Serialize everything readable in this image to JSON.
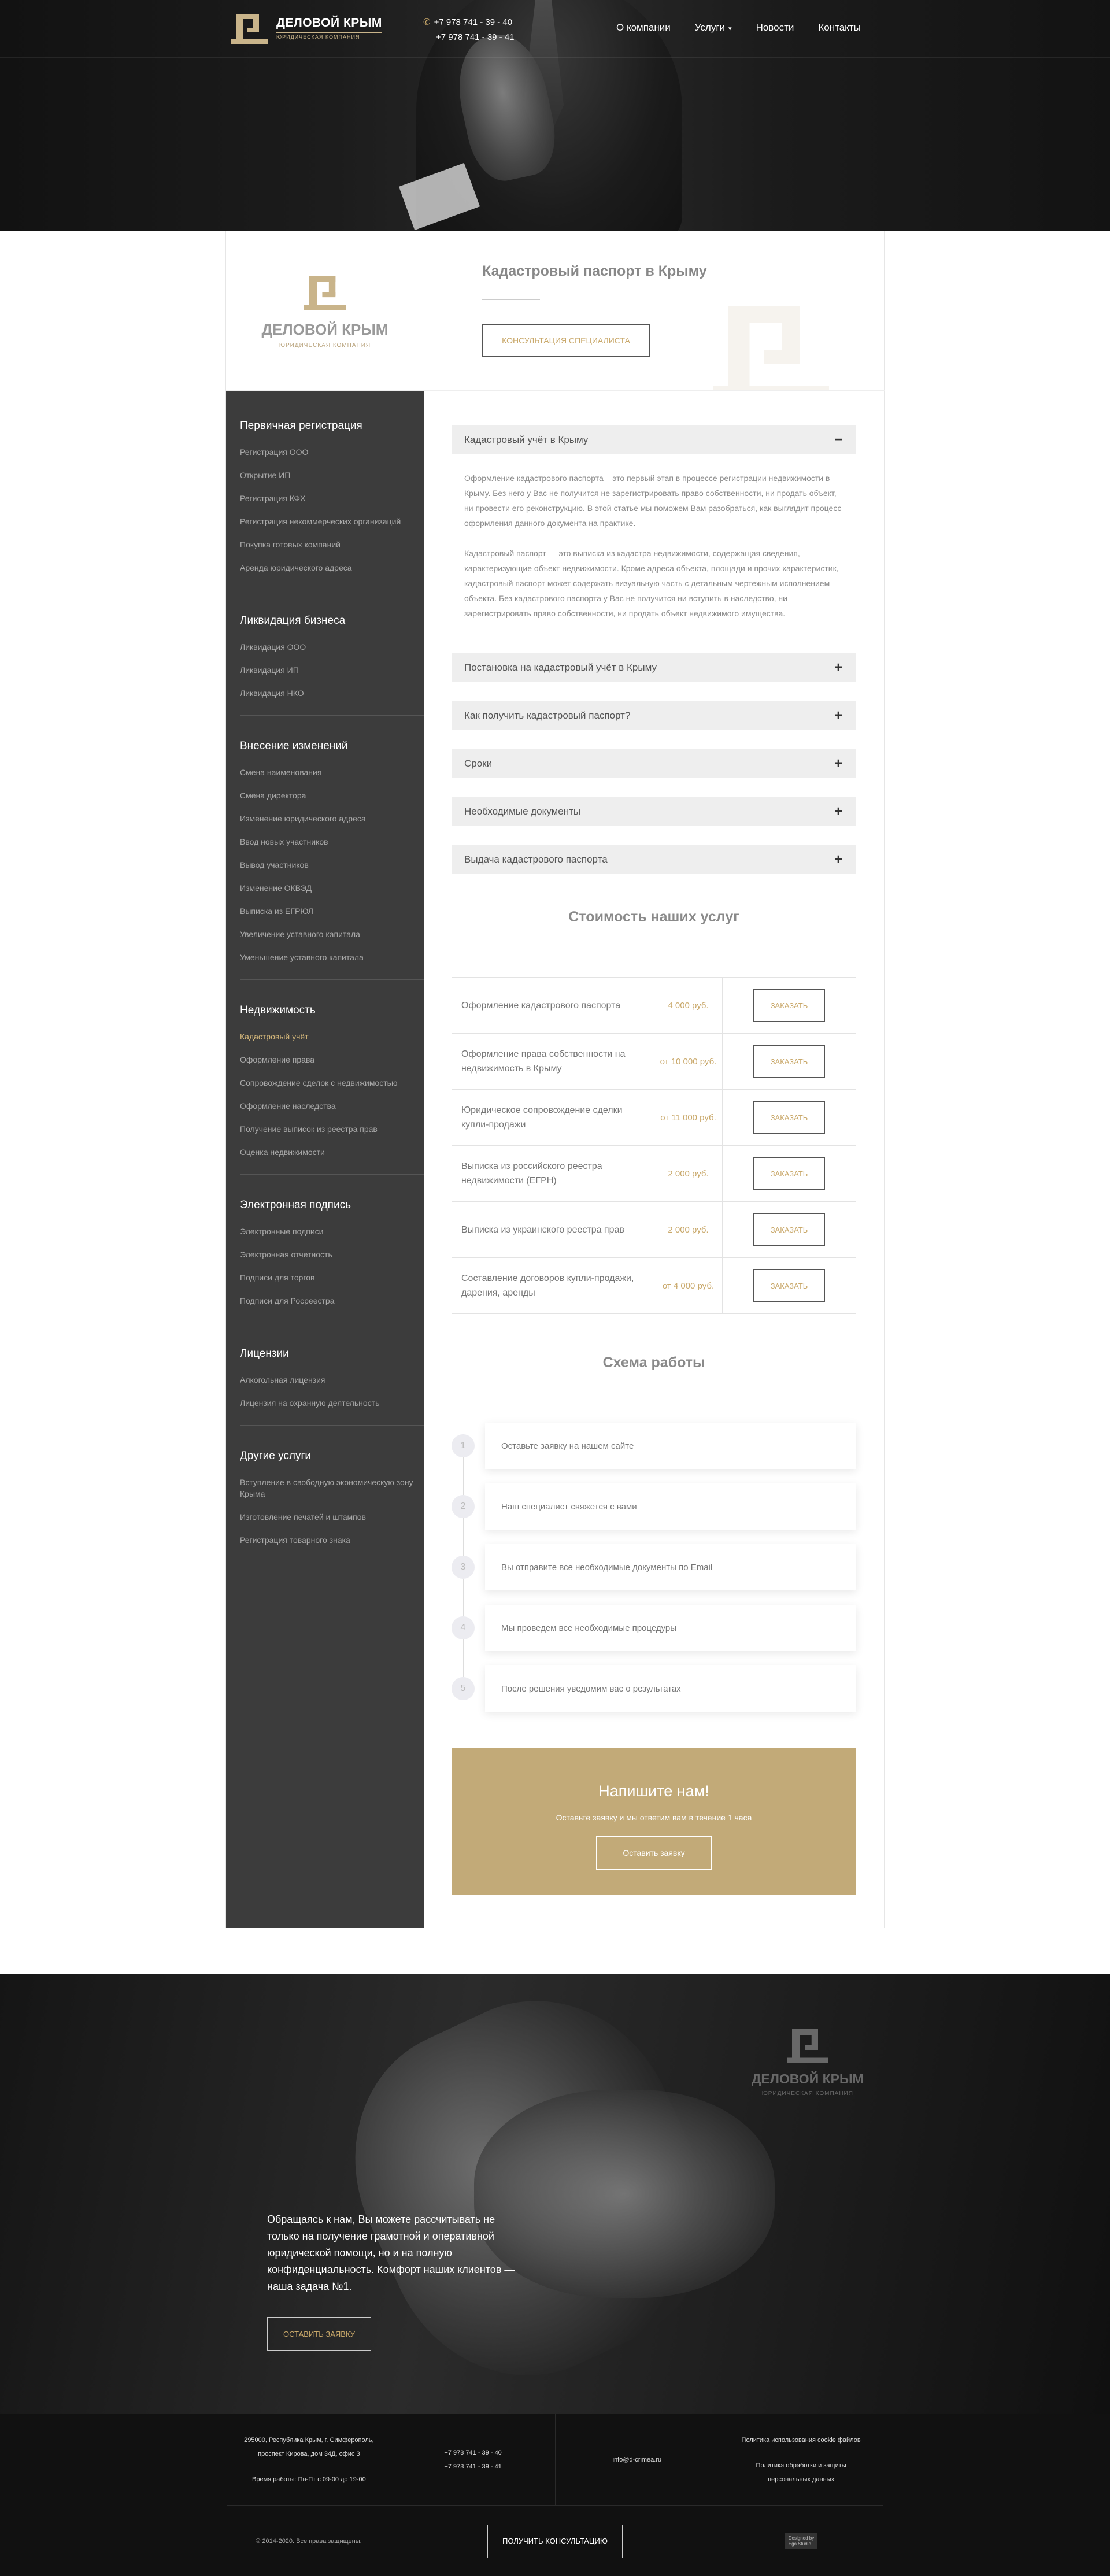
{
  "header": {
    "logo_name": "ДЕЛОВОЙ КРЫМ",
    "logo_sub": "ЮРИДИЧЕСКАЯ КОМПАНИЯ",
    "phone1": "+7 978 741 - 39 - 40",
    "phone2": "+7 978 741 - 39 - 41",
    "nav": [
      "О компании",
      "Услуги",
      "Новости",
      "Контакты"
    ]
  },
  "page": {
    "title": "Кадастровый паспорт в Крыму",
    "consult_button": "КОНСУЛЬТАЦИЯ СПЕЦИАЛИСТА"
  },
  "sidebar": {
    "logo_name": "ДЕЛОВОЙ КРЫМ",
    "logo_sub": "ЮРИДИЧЕСКАЯ КОМПАНИЯ",
    "groups": [
      {
        "title": "Первичная регистрация",
        "items": [
          "Регистрация ООО",
          "Открытие ИП",
          "Регистрация КФХ",
          "Регистрация некоммерческих организаций",
          "Покупка готовых компаний",
          "Аренда юридического адреса"
        ]
      },
      {
        "title": "Ликвидация бизнеса",
        "items": [
          "Ликвидация ООО",
          "Ликвидация ИП",
          "Ликвидация НКО"
        ]
      },
      {
        "title": "Внесение изменений",
        "items": [
          "Смена наименования",
          "Смена директора",
          "Изменение юридического адреса",
          "Ввод новых участников",
          "Вывод участников",
          "Изменение ОКВЭД",
          "Выписка из ЕГРЮЛ",
          "Увеличение уставного капитала",
          "Уменьшение уставного капитала"
        ]
      },
      {
        "title": "Недвижимость",
        "items": [
          "Кадастровый учёт",
          "Оформление права",
          "Сопровождение сделок с недвижимостью",
          "Оформление наследства",
          "Получение выписок из реестра прав",
          "Оценка недвижимости"
        ]
      },
      {
        "title": "Электронная подпись",
        "items": [
          "Электронные подписи",
          "Электронная отчетность",
          "Подписи для торгов",
          "Подписи для Росреестра"
        ]
      },
      {
        "title": "Лицензии",
        "items": [
          "Алкогольная лицензия",
          "Лицензия на охранную деятельность"
        ]
      },
      {
        "title": "Другие услуги",
        "items": [
          "Вступление в свободную экономическую зону Крыма",
          "Изготовление печатей и штампов",
          "Регистрация товарного знака"
        ]
      }
    ]
  },
  "accordion": {
    "open_title": "Кадастровый учёт в Крыму",
    "open_sign": "−",
    "paragraph1": "Оформление кадастрового паспорта – это первый этап в процессе регистрации недвижимости в Крыму. Без него у Вас не получится не зарегистрировать право собственности, ни продать объект, ни провести его реконструкцию. В этой статье мы поможем Вам разобраться, как выглядит процесс оформления данного документа на практике.",
    "paragraph2": "Кадастровый паспорт — это выписка из кадастра недвижимости, содержащая сведения, характеризующие объект недвижимости. Кроме адреса объекта, площади и прочих характеристик, кадастровый паспорт может содержать визуальную часть с детальным чертежным исполнением объекта. Без кадастрового паспорта у Вас не получится ни вступить в наследство, ни зарегистрировать право собственности, ни продать объект недвижимого имущества.",
    "closed": [
      "Постановка на кадастровый учёт в Крыму",
      "Как получить кадастровый паспорт?",
      "Сроки",
      "Необходимые документы",
      "Выдача кадастрового паспорта"
    ],
    "closed_sign": "+"
  },
  "prices": {
    "title": "Стоимость наших услуг",
    "order_label": "ЗАКАЗАТЬ",
    "rows": [
      {
        "service": "Оформление кадастрового паспорта",
        "price": "4 000 руб."
      },
      {
        "service": "Оформление права собственности на недвижимость в Крыму",
        "price": "от 10 000 руб."
      },
      {
        "service": "Юридическое сопровождение сделки купли-продажи",
        "price": "от 11 000 руб."
      },
      {
        "service": "Выписка из российского реестра недвижимости (ЕГРН)",
        "price": "2 000 руб."
      },
      {
        "service": "Выписка из украинского реестра прав",
        "price": "2 000 руб."
      },
      {
        "service": "Составление договоров купли-продажи, дарения, аренды",
        "price": "от 4 000 руб."
      }
    ]
  },
  "steps": {
    "title": "Схема работы",
    "items": [
      {
        "num": "1",
        "text": "Оставьте заявку на нашем сайте"
      },
      {
        "num": "2",
        "text": "Наш специалист свяжется с вами"
      },
      {
        "num": "3",
        "text": "Вы отправите все необходимые документы по Email"
      },
      {
        "num": "4",
        "text": "Мы проведем все необходимые процедуры"
      },
      {
        "num": "5",
        "text": "После решения уведомим вас о результатах"
      }
    ]
  },
  "cta": {
    "title": "Напишите нам!",
    "text": "Оставьте заявку и мы ответим вам в течение 1 часа",
    "button": "Оставить заявку"
  },
  "banner": {
    "logo_name": "ДЕЛОВОЙ КРЫМ",
    "logo_sub": "ЮРИДИЧЕСКАЯ КОМПАНИЯ",
    "text": "Обращаясь к нам, Вы можете рассчитывать не только на получение грамотной и оперативной юридической помощи, но и на полную конфиденциальность. Комфорт наших клиентов — наша задача №1.",
    "button": "ОСТАВИТЬ ЗАЯВКУ"
  },
  "footer": {
    "address1": "295000, Республика Крым, г. Симферополь,",
    "address2": "проспект Кирова, дом 34Д, офис 3",
    "hours": "Время работы: Пн-Пт с 09-00 до 19-00",
    "phone1": "+7 978 741 - 39 - 40",
    "phone2": "+7 978 741 - 39 - 41",
    "email": "info@d-crimea.ru",
    "cookies": "Политика использования cookie файлов",
    "privacy": "Политика обработки и защиты персональных данных",
    "copyright": "© 2014-2020. Все права защищены.",
    "consult_button": "ПОЛУЧИТЬ КОНСУЛЬТАЦИЮ",
    "dev_line1": "Designed by",
    "dev_line2": "Ego Studio"
  },
  "colors": {
    "accent": "#c9a86a",
    "sidebar_bg": "#3c3c3c",
    "cta_bg": "#c2aa78",
    "footer_bg": "#111111"
  }
}
